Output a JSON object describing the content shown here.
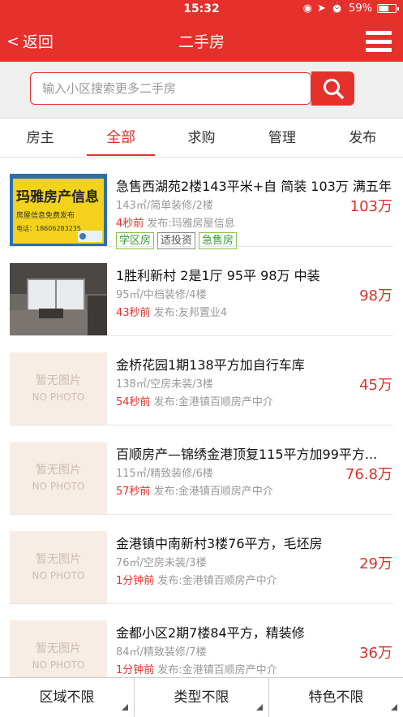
{
  "status": {
    "time": "15:32",
    "battery": "59%",
    "battery_level": 0.59
  },
  "nav": {
    "back_label": "返回",
    "title": "二手房"
  },
  "search": {
    "placeholder": "输入小区搜索更多二手房"
  },
  "tabs": [
    {
      "label": "房主",
      "active": false
    },
    {
      "label": "全部",
      "active": true
    },
    {
      "label": "求购",
      "active": false
    },
    {
      "label": "管理",
      "active": false
    },
    {
      "label": "发布",
      "active": false
    }
  ],
  "listings": [
    {
      "title": "急售西湖苑2楼143平米+自 简装 103万 满五年",
      "sub": "143㎡/简单装修/2楼",
      "time": "4秒前",
      "publisher": "发布:玛雅房屋信息",
      "price": "103万",
      "tags": [
        "学区房",
        "适投资",
        "急售房"
      ],
      "thumb": "sign",
      "sign_title": "玛雅房产信息",
      "sign_line": "房屋信息免费发布",
      "sign_phone": "电话：18606283235"
    },
    {
      "title": "1胜利新村 2是1厅 95平 98万 中装",
      "sub": "95㎡/中档装修/4楼",
      "time": "43秒前",
      "publisher": "发布:友邦置业4",
      "price": "98万",
      "tags": [],
      "thumb": "room"
    },
    {
      "title": "金桥花园1期138平方加自行车库",
      "sub": "138㎡/空房未装/3楼",
      "time": "54秒前",
      "publisher": "发布:金港镇百顺房产中介",
      "price": "45万",
      "tags": [],
      "thumb": "nophoto"
    },
    {
      "title": "百顺房产—锦绣金港顶复115平方加99平方...",
      "sub": "115㎡/精致装修/6楼",
      "time": "57秒前",
      "publisher": "发布:金港镇百顺房产中介",
      "price": "76.8万",
      "tags": [],
      "thumb": "nophoto"
    },
    {
      "title": "金港镇中南新村3楼76平方，毛坯房",
      "sub": "76㎡/空房未装/3楼",
      "time": "1分钟前",
      "publisher": "发布:金港镇百顺房产中介",
      "price": "29万",
      "tags": [],
      "thumb": "nophoto"
    },
    {
      "title": "金都小区2期7楼84平方，精装修",
      "sub": "84㎡/精致装修/7楼",
      "time": "1分钟前",
      "publisher": "发布:金港镇百顺房产中介",
      "price": "36万",
      "tags": [],
      "thumb": "nophoto"
    }
  ],
  "nophoto": {
    "cn": "暂无图片",
    "en": "NO PHOTO"
  },
  "filters": [
    {
      "label": "区域不限"
    },
    {
      "label": "类型不限"
    },
    {
      "label": "特色不限"
    }
  ],
  "colors": {
    "brand": "#e5302c",
    "price": "#d9322c"
  }
}
